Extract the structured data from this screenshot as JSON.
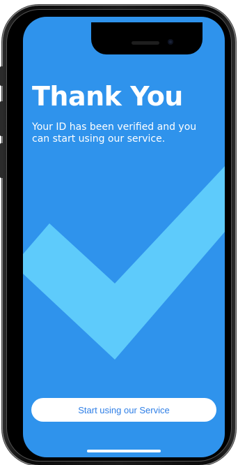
{
  "screen": {
    "title": "Thank You",
    "subtitle": "Your ID has been verified and you can start using our service.",
    "cta_label": "Start using our Service"
  },
  "icons": {
    "hero": "checkmark-icon"
  },
  "colors": {
    "background": "#2f93ec",
    "checkmark": "#5ecbfb",
    "button_background": "#ffffff",
    "button_text": "#2f7fe6",
    "title_text": "#ffffff"
  }
}
